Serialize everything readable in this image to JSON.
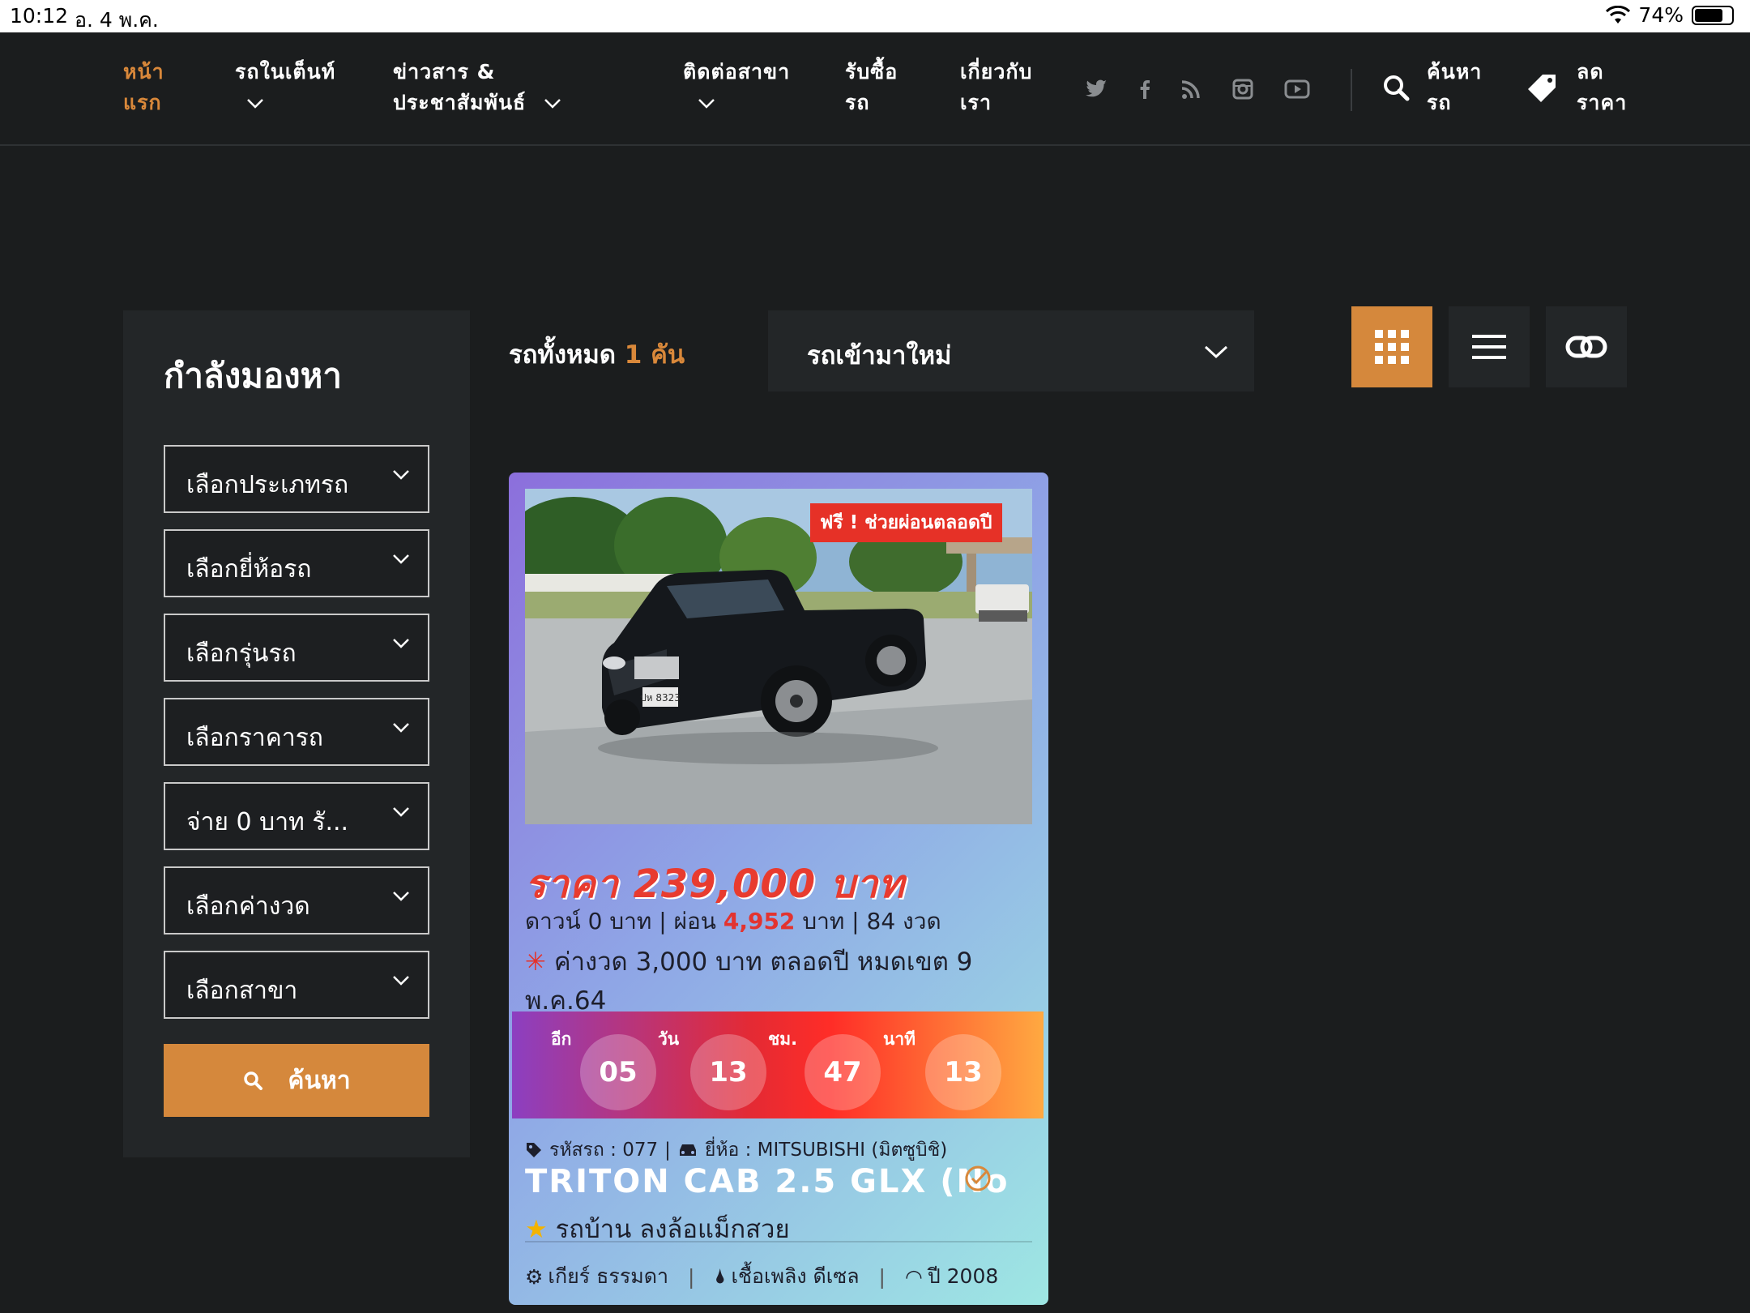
{
  "status": {
    "time": "10:12",
    "date": "อ. 4 พ.ค.",
    "battery": "74%"
  },
  "nav": {
    "items": [
      {
        "line1": "หน้า",
        "line2": "แรก"
      },
      {
        "line1": "รถในเต็นท์",
        "line2": ""
      },
      {
        "line1": "ข่าวสาร &",
        "line2": "ประชาสัมพันธ์"
      },
      {
        "line1": "ติดต่อสาขา",
        "line2": ""
      },
      {
        "line1": "รับซื้อ",
        "line2": "รถ"
      },
      {
        "line1": "เกี่ยวกับ",
        "line2": "เรา"
      }
    ],
    "social_icons": [
      "twitter-icon",
      "facebook-icon",
      "rss-icon",
      "instagram-icon",
      "youtube-icon"
    ],
    "search": {
      "line1": "ค้นหา",
      "line2": "รถ"
    },
    "discount": {
      "line1": "ลด",
      "line2": "ราคา"
    },
    "accent_color": "#d9883a"
  },
  "sidebar": {
    "title": "กำลังมองหา",
    "selects": [
      "เลือกประเภทรถ",
      "เลือกยี่ห้อรถ",
      "เลือกรุ่นรถ",
      "เลือกราคารถ",
      "จ่าย 0 บาท รั...",
      "เลือกค่างวด",
      "เลือกสาขา"
    ],
    "search_label": "ค้นหา"
  },
  "toolbar": {
    "total_prefix": "รถทั้งหมด",
    "total_count": "1",
    "total_unit": "คัน",
    "sort_value": "รถเข้ามาใหม่",
    "views": [
      "grid-view-icon",
      "list-view-icon",
      "link-icon"
    ],
    "active_view": "grid-view-icon"
  },
  "card": {
    "promo_badge": "ฟรี ! ช่วยผ่อนตลอดปี",
    "price": "ราคา 239,000 บาท",
    "down_a": "ดาวน์ 0 บาท | ผ่อน",
    "installment": "4,952",
    "down_b": "บาท | 84 งวด",
    "promo_note": "ค่างวด 3,000 บาท ตลอดปี หมดเขต 9 พ.ค.64",
    "countdown": {
      "prefix": "อีก",
      "items": [
        {
          "value": "05",
          "label": "วัน"
        },
        {
          "value": "13",
          "label": "ชม."
        },
        {
          "value": "47",
          "label": "นาที"
        },
        {
          "value": "13",
          "label": ""
        }
      ]
    },
    "code_label": "รหัสรถ : 077",
    "brand_label": "ยี่ห้อ : MITSUBISHI (มิตซูบิชิ)",
    "title": "TRITON CAB 2.5 GLX (No",
    "subtitle": "รถบ้าน ลงล้อแม็กสวย",
    "specs": {
      "gear": "เกียร์ ธรรมดา",
      "fuel": "เชื้อเพลิง ดีเซล",
      "year": "ปี 2008"
    },
    "plate_text": "ปห 8323"
  }
}
